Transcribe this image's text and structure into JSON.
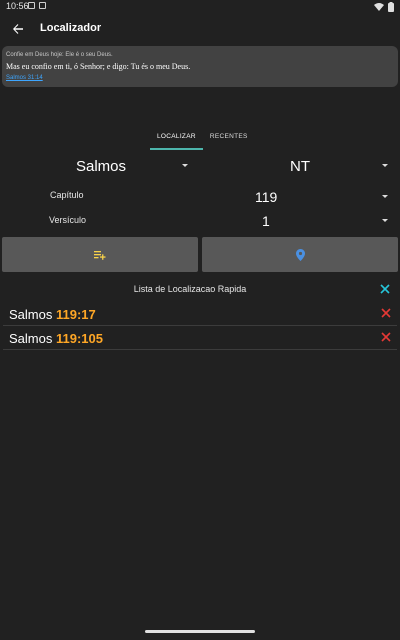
{
  "status_bar": {
    "time": "10:56"
  },
  "app_bar": {
    "title": "Localizador"
  },
  "verse_card": {
    "header": "Confie em Deus hoje: Ele é o seu Deus.",
    "text": "Mas eu confio em ti, ó Senhor; e digo: Tu és o meu Deus.",
    "reference": "Salmos 31:14"
  },
  "tabs": [
    {
      "label": "LOCALIZAR",
      "active": true
    },
    {
      "label": "RECENTES",
      "active": false
    }
  ],
  "selectors": {
    "book": "Salmos",
    "testament": "NT",
    "chapter_label": "Capítulo",
    "chapter_value": "119",
    "verse_label": "Versículo",
    "verse_value": "1"
  },
  "actions": {
    "add_icon": "playlist-add-icon",
    "locate_icon": "location-pin-icon"
  },
  "quick_list": {
    "title": "Lista de Localizacao Rapida",
    "items": [
      {
        "book": "Salmos",
        "ref": "119:17"
      },
      {
        "book": "Salmos",
        "ref": "119:105"
      }
    ]
  },
  "colors": {
    "background": "#212121",
    "card": "#424242",
    "button": "#585858",
    "accent_teal": "#4db6ac",
    "reference_orange": "#ffa726",
    "delete_red": "#e53935",
    "link_blue": "#3ea6ff",
    "pin_blue": "#4a90e2",
    "add_yellow": "#f9d34a"
  }
}
